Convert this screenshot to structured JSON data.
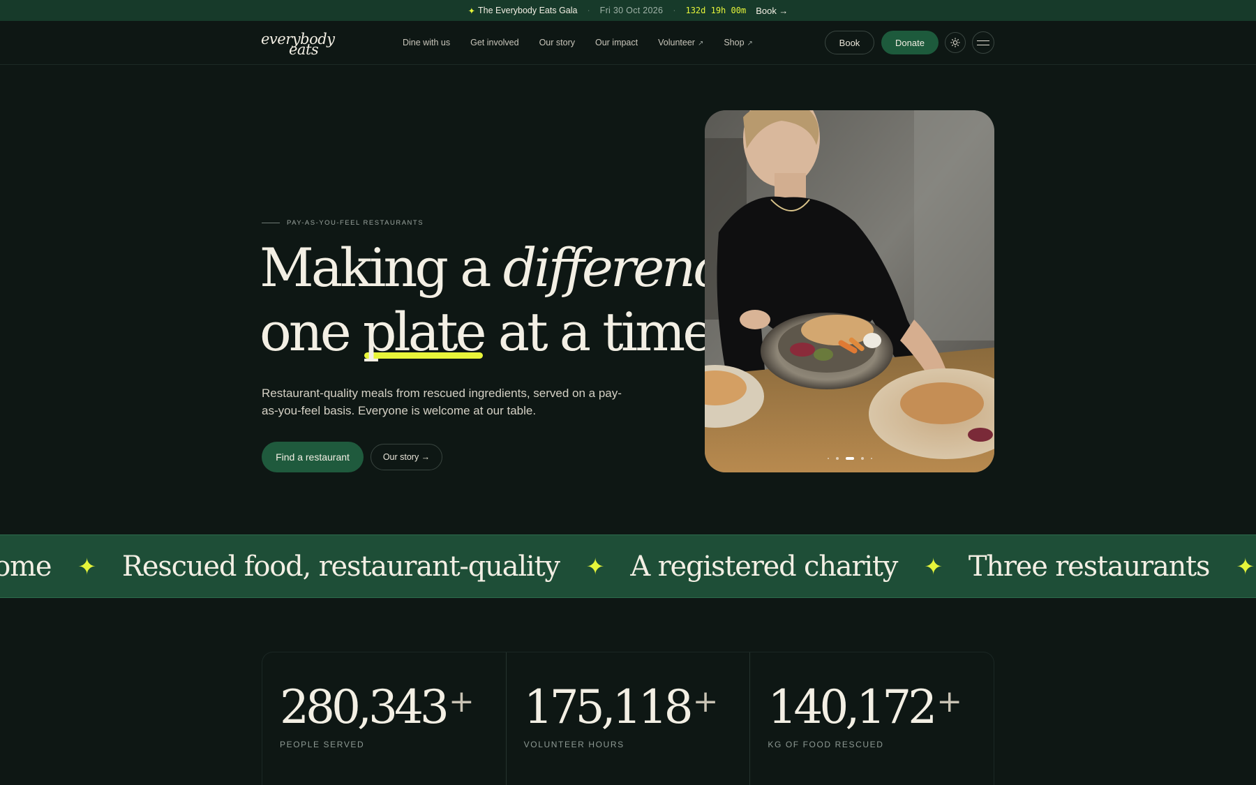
{
  "announcement": {
    "event": "The Everybody Eats Gala",
    "date": "Fri 30 Oct 2026",
    "countdown": "132d 19h 00m",
    "cta": "Book →"
  },
  "nav": {
    "logo_line1": "everybody",
    "logo_line2": "eats",
    "links": [
      "Dine with us",
      "Get involved",
      "Our story",
      "Our impact",
      "Volunteer",
      "Shop"
    ],
    "book_label": "Book",
    "donate_label": "Donate"
  },
  "hero": {
    "eyebrow": "PAY-AS-YOU-FEEL RESTAURANTS",
    "headline_a": "Making a ",
    "headline_b": "difference",
    "headline_c": "one ",
    "headline_d": "plate",
    "headline_e": " at a time.",
    "lede": "Restaurant-quality meals from rescued ingredients, served on a pay-as-you-feel basis. Everyone is welcome at our table.",
    "primary_cta": "Find a restaurant",
    "secondary_cta": "Our story →",
    "slide_count": 5,
    "active_slide": 3
  },
  "marquee": {
    "items": [
      "come",
      "Rescued food, restaurant-quality",
      "A registered charity",
      "Three restaurants"
    ]
  },
  "stats": [
    {
      "value": "280,343",
      "suffix": "+",
      "label": "PEOPLE SERVED"
    },
    {
      "value": "175,118",
      "suffix": "+",
      "label": "VOLUNTEER HOURS"
    },
    {
      "value": "140,172",
      "suffix": "+",
      "label": "KG OF FOOD RESCUED"
    }
  ],
  "colors": {
    "background": "#0e1714",
    "brand_green": "#1d5a3c",
    "accent_yellow": "#e6f53a",
    "cream": "#f3efe4"
  }
}
